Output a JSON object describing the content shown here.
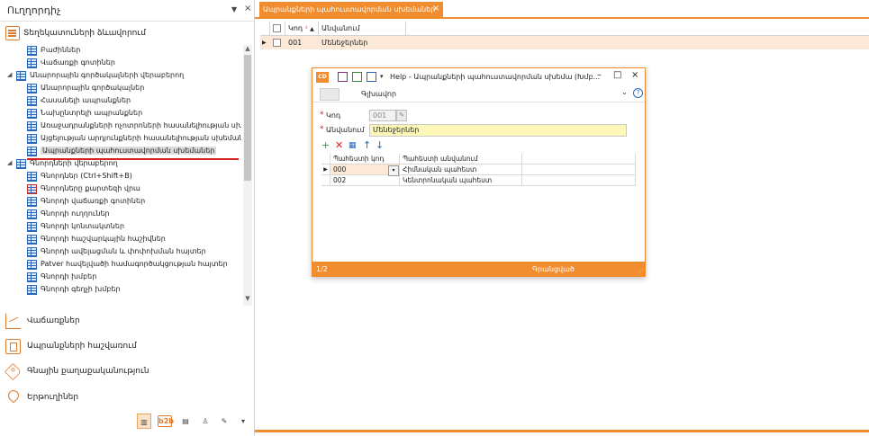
{
  "left_panel": {
    "title": "Ուղղորդիչ",
    "root_label": "Տեղեկատուների ձևավորում",
    "tree": [
      {
        "label": "Բաժիններ",
        "level": 1
      },
      {
        "label": "Վաճառքի գոտիներ",
        "level": 1
      },
      {
        "label": "Անարորային գործակալների վերաբերող",
        "level": 0,
        "expanded": true
      },
      {
        "label": "Անարորային գործակալներ",
        "level": 1
      },
      {
        "label": "Հասանելի ապրանքներ",
        "level": 1
      },
      {
        "label": "Նախընտրելի ապրանքներ",
        "level": 1
      },
      {
        "label": "Առաջադրանքների ոչոտրոների հասանելիության սխեմ",
        "level": 1
      },
      {
        "label": "Այցելության արդյունքների հասանելիության սխեմանե",
        "level": 1
      },
      {
        "label": "Ապրանքների պահուստավորման սխեմաներ",
        "level": 1,
        "selected": true
      },
      {
        "label": "Գնորդների վերաբերող",
        "level": 0,
        "expanded": true
      },
      {
        "label": "Գնորդներ (Ctrl+Shift+B)",
        "level": 1
      },
      {
        "label": "Գնորդները քարտեզի վրա",
        "level": 1,
        "red": true
      },
      {
        "label": "Գնորդի վաճառքի գոտիներ",
        "level": 1
      },
      {
        "label": "Գնորդի ուղղուներ",
        "level": 1
      },
      {
        "label": "Գնորդի կոնտակտներ",
        "level": 1
      },
      {
        "label": "Գնորդի հաշվարկային հաշիվներ",
        "level": 1
      },
      {
        "label": "Գնորդի ավելացման և փոփոխման հայտեր",
        "level": 1
      },
      {
        "label": "Patver հավելվածի համագործակցության հայտեր",
        "level": 1
      },
      {
        "label": "Գնորդի խմբեր",
        "level": 1
      },
      {
        "label": "Գնորդի գեղչի խմբեր",
        "level": 1
      }
    ],
    "sections": [
      {
        "label": "Վաճառքներ",
        "icon": "sales-chart-icon"
      },
      {
        "label": "Ապրանքների հաշվառում",
        "icon": "inventory-box-icon"
      },
      {
        "label": "Գնային քաղաքականություն",
        "icon": "price-tag-icon"
      },
      {
        "label": "Երթուղիներ",
        "icon": "location-pin-icon"
      }
    ],
    "bottom_toolbar": {
      "b2b_label": "b2b",
      "icons": [
        "reports-icon",
        "b2b-icon",
        "clipboard-icon",
        "user-settings-icon",
        "tools-icon",
        "more-dropdown-icon"
      ]
    }
  },
  "main": {
    "tab_label": "Ապրանքների պահուստավորման սխեմաներ",
    "grid": {
      "columns": [
        "Կոդ",
        "Անվանում"
      ],
      "rows": [
        {
          "code": "001",
          "name": "Մենեջերներ"
        }
      ]
    }
  },
  "dialog": {
    "app_icon_label": "CD",
    "title": "Help - Ապրանքների պահուստավորման սխեմա (Խմբ...",
    "tab_label": "Գլխավոր",
    "help_label": "?",
    "fields": {
      "code_label": "Կոդ",
      "code_value": "001",
      "name_label": "Անվանում",
      "name_value": "Մենեջերներ"
    },
    "sub_grid": {
      "columns": [
        "Պահեստի կոդ",
        "Պահեստի անվանում"
      ],
      "rows": [
        {
          "code": "000",
          "name": "Հիմնական պահեստ",
          "active": true
        },
        {
          "code": "002",
          "name": "Կենտրոնական պահեստ"
        }
      ]
    },
    "status": {
      "pager": "1/2",
      "text": "Գրանցված"
    }
  },
  "colors": {
    "accent": "#f28d2f",
    "selection_row": "#fbe8d6",
    "required_field": "#fdf7b8",
    "selection_underline": "#d42020"
  }
}
